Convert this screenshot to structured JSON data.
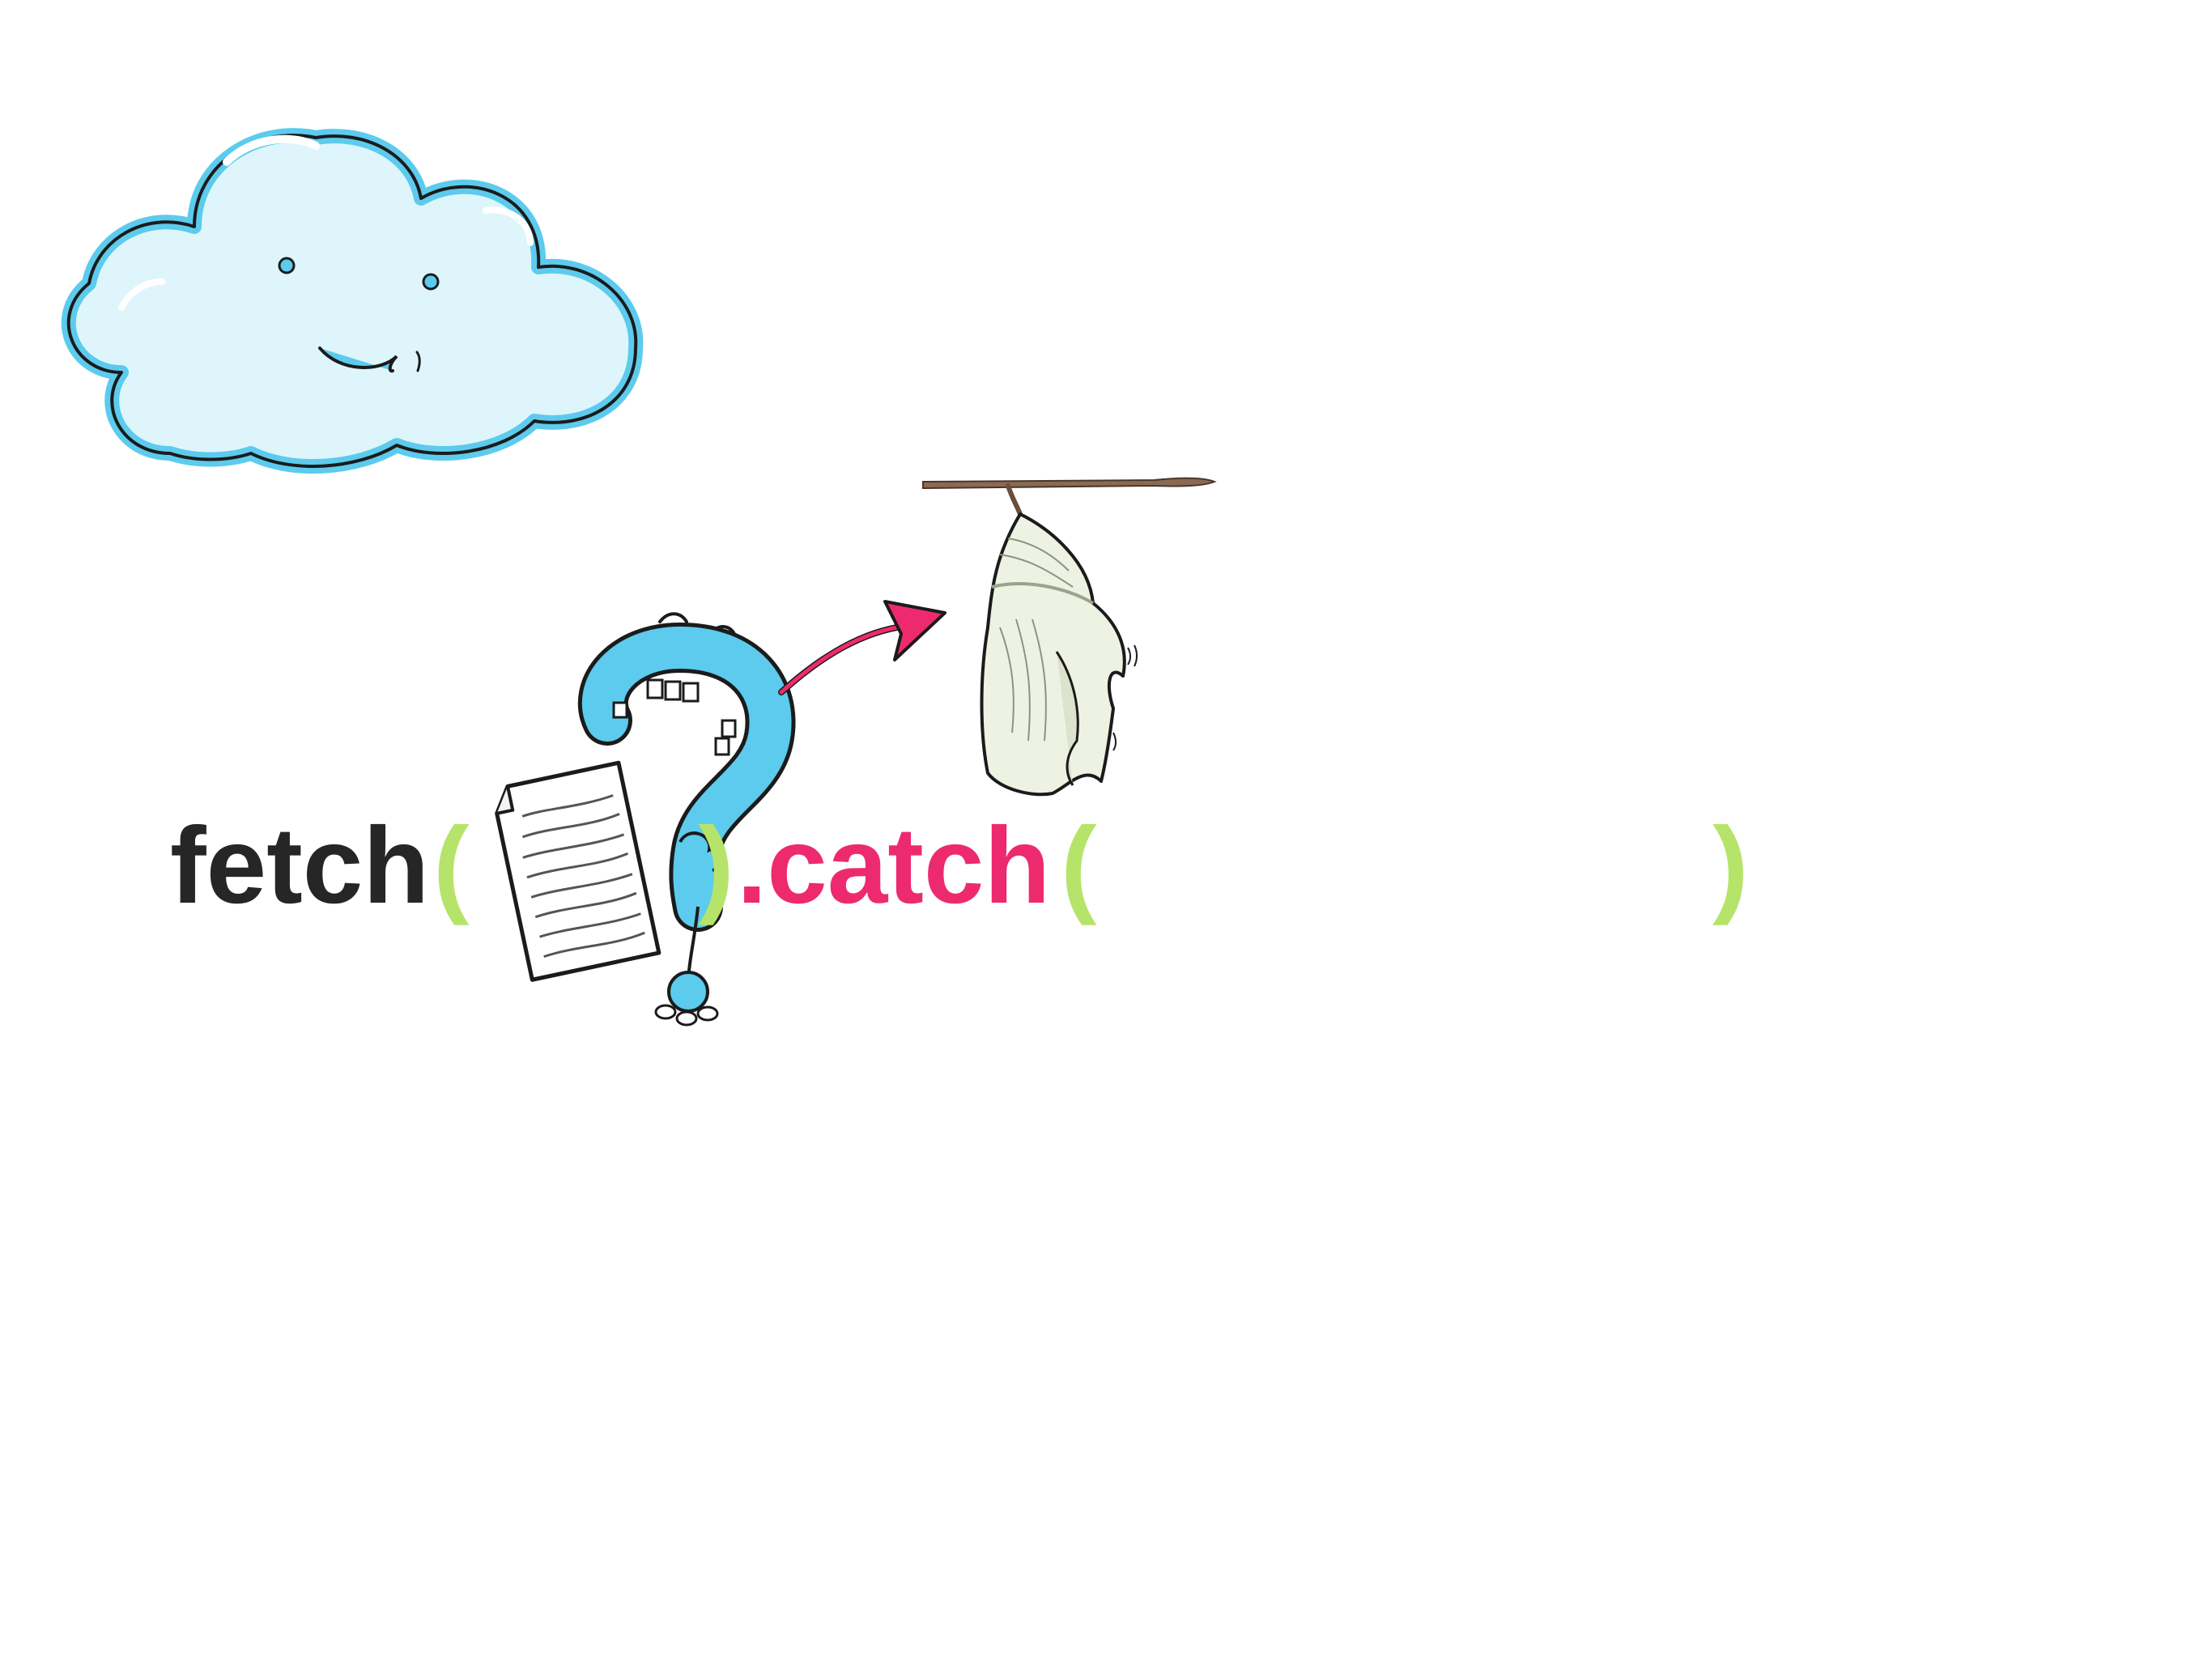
{
  "code": {
    "fetch_label": "fetch",
    "open_paren_1": "(",
    "close_paren_1": ")",
    "catch_label": ".catch",
    "open_paren_2": "(",
    "close_paren_2": ")"
  },
  "colors": {
    "background": "#ffffff",
    "fetch_text": "#262626",
    "catch_text": "#ee2a6f",
    "paren": "#b6e46a",
    "cloud_fill": "#dff5fc",
    "cloud_stroke": "#5ccbed",
    "question_mark": "#5ccbed",
    "arrow": "#ee2a6f",
    "chrysalis_fill": "#eef2e2",
    "branch": "#8a6a52"
  },
  "illustrations": {
    "cloud": "smiling-cloud-icon",
    "question": "question-mark-with-document-icon",
    "arrow": "curved-arrow-icon",
    "chrysalis": "chrysalis-icon"
  }
}
